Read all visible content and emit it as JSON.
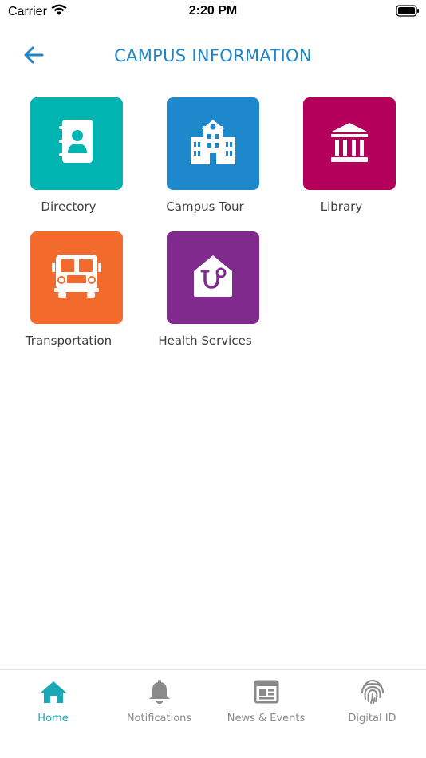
{
  "status_bar": {
    "carrier": "Carrier",
    "time": "2:20 PM"
  },
  "header": {
    "title": "CAMPUS INFORMATION",
    "back_icon": "arrow-left-icon"
  },
  "tiles": [
    {
      "label": "Directory",
      "color": "#00b4b1",
      "icon": "address-book-icon"
    },
    {
      "label": "Campus Tour",
      "color": "#1e88cc",
      "icon": "campus-building-icon"
    },
    {
      "label": "Library",
      "color": "#b5005b",
      "icon": "library-building-icon"
    },
    {
      "label": "Transportation",
      "color": "#f26b2c",
      "icon": "bus-icon"
    },
    {
      "label": "Health Services",
      "color": "#7f2a8c",
      "icon": "stethoscope-icon"
    }
  ],
  "bottom_nav": {
    "active_color": "#1aa7b6",
    "inactive_color": "#8a8a8a",
    "items": [
      {
        "label": "Home",
        "icon": "home-icon",
        "active": true
      },
      {
        "label": "Notifications",
        "icon": "bell-icon",
        "active": false
      },
      {
        "label": "News & Events",
        "icon": "newspaper-icon",
        "active": false
      },
      {
        "label": "Digital ID",
        "icon": "fingerprint-icon",
        "active": false
      }
    ]
  }
}
